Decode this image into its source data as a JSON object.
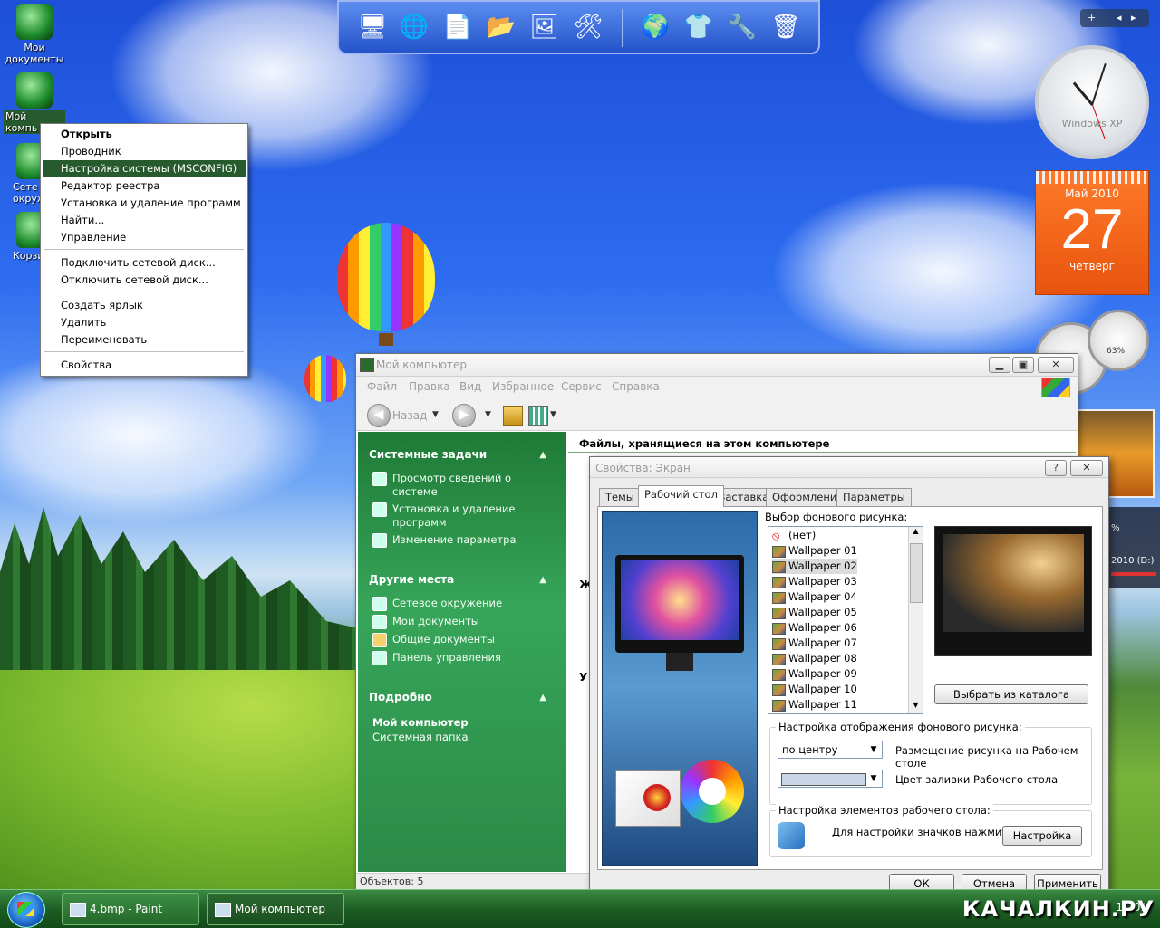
{
  "desktop": {
    "icons": [
      {
        "label": "Мои документы"
      },
      {
        "label": "Мой компьютер"
      },
      {
        "label": "Сетевое окружение"
      },
      {
        "label": "Корзина"
      }
    ],
    "icons_visible_text": [
      "Мои\nдокументы",
      "Мой\nкомпь",
      "Сете\nокруж",
      "Корзи"
    ]
  },
  "context_menu": {
    "items": [
      {
        "label": "Открыть",
        "bold": true
      },
      {
        "label": "Проводник"
      },
      {
        "label": "Настройка системы (MSCONFIG)",
        "selected": true
      },
      {
        "label": "Редактор реестра"
      },
      {
        "label": "Установка и удаление программ"
      },
      {
        "label": "Найти..."
      },
      {
        "label": "Управление"
      },
      {
        "label": "Подключить сетевой диск..."
      },
      {
        "label": "Отключить сетевой диск..."
      },
      {
        "label": "Создать ярлык"
      },
      {
        "label": "Удалить"
      },
      {
        "label": "Переименовать"
      },
      {
        "label": "Свойства"
      }
    ]
  },
  "gadgets": {
    "clock_label": "Windows XP",
    "calendar": {
      "month_year": "Май 2010",
      "day": "27",
      "weekday": "четверг"
    },
    "meter_percent": "63%",
    "drive_label": "2010 (D:)",
    "percent_sign": "%"
  },
  "explorer": {
    "title": "Мой компьютер",
    "menu": [
      "Файл",
      "Правка",
      "Вид",
      "Избранное",
      "Сервис",
      "Справка"
    ],
    "back_label": "Назад",
    "header": "Файлы, хранящиеся на этом компьютере",
    "partial_labels": [
      "Ж",
      "У"
    ],
    "sections": {
      "system_tasks": {
        "title": "Системные задачи",
        "links": [
          "Просмотр сведений о системе",
          "Установка и удаление программ",
          "Изменение параметра"
        ]
      },
      "other_places": {
        "title": "Другие места",
        "links": [
          "Сетевое окружение",
          "Мои документы",
          "Общие документы",
          "Панель управления"
        ]
      },
      "details": {
        "title": "Подробно",
        "name": "Мой компьютер",
        "type": "Системная папка"
      }
    },
    "status": "Объектов: 5"
  },
  "dialog": {
    "title": "Свойства: Экран",
    "tabs": [
      "Темы",
      "Рабочий стол",
      "Заставка",
      "Оформление",
      "Параметры"
    ],
    "active_tab": "Рабочий стол",
    "bg_label": "Выбор фонового рисунка:",
    "wallpapers": [
      "(нет)",
      "Wallpaper 01",
      "Wallpaper 02",
      "Wallpaper 03",
      "Wallpaper 04",
      "Wallpaper 05",
      "Wallpaper 06",
      "Wallpaper 07",
      "Wallpaper 08",
      "Wallpaper 09",
      "Wallpaper 10",
      "Wallpaper 11"
    ],
    "selected_wallpaper": "Wallpaper 02",
    "catalog_button": "Выбрать из каталога",
    "display_group": "Настройка отображения фонового рисунка:",
    "position_value": "по центру",
    "position_label": "Размещение рисунка на Рабочем столе",
    "fill_label": "Цвет заливки Рабочего стола",
    "fill_color": "#c8d6e8",
    "elements_group": "Настройка элементов рабочего стола:",
    "elements_text": "Для настройки значков нажмите:",
    "elements_button": "Настройка",
    "ok": "ОК",
    "cancel": "Отмена",
    "apply": "Применить"
  },
  "taskbar": {
    "tasks": [
      "4.bmp - Paint",
      "Мой компьютер"
    ],
    "clock": "17:01"
  },
  "watermark": "КАЧАЛКИН.РУ"
}
